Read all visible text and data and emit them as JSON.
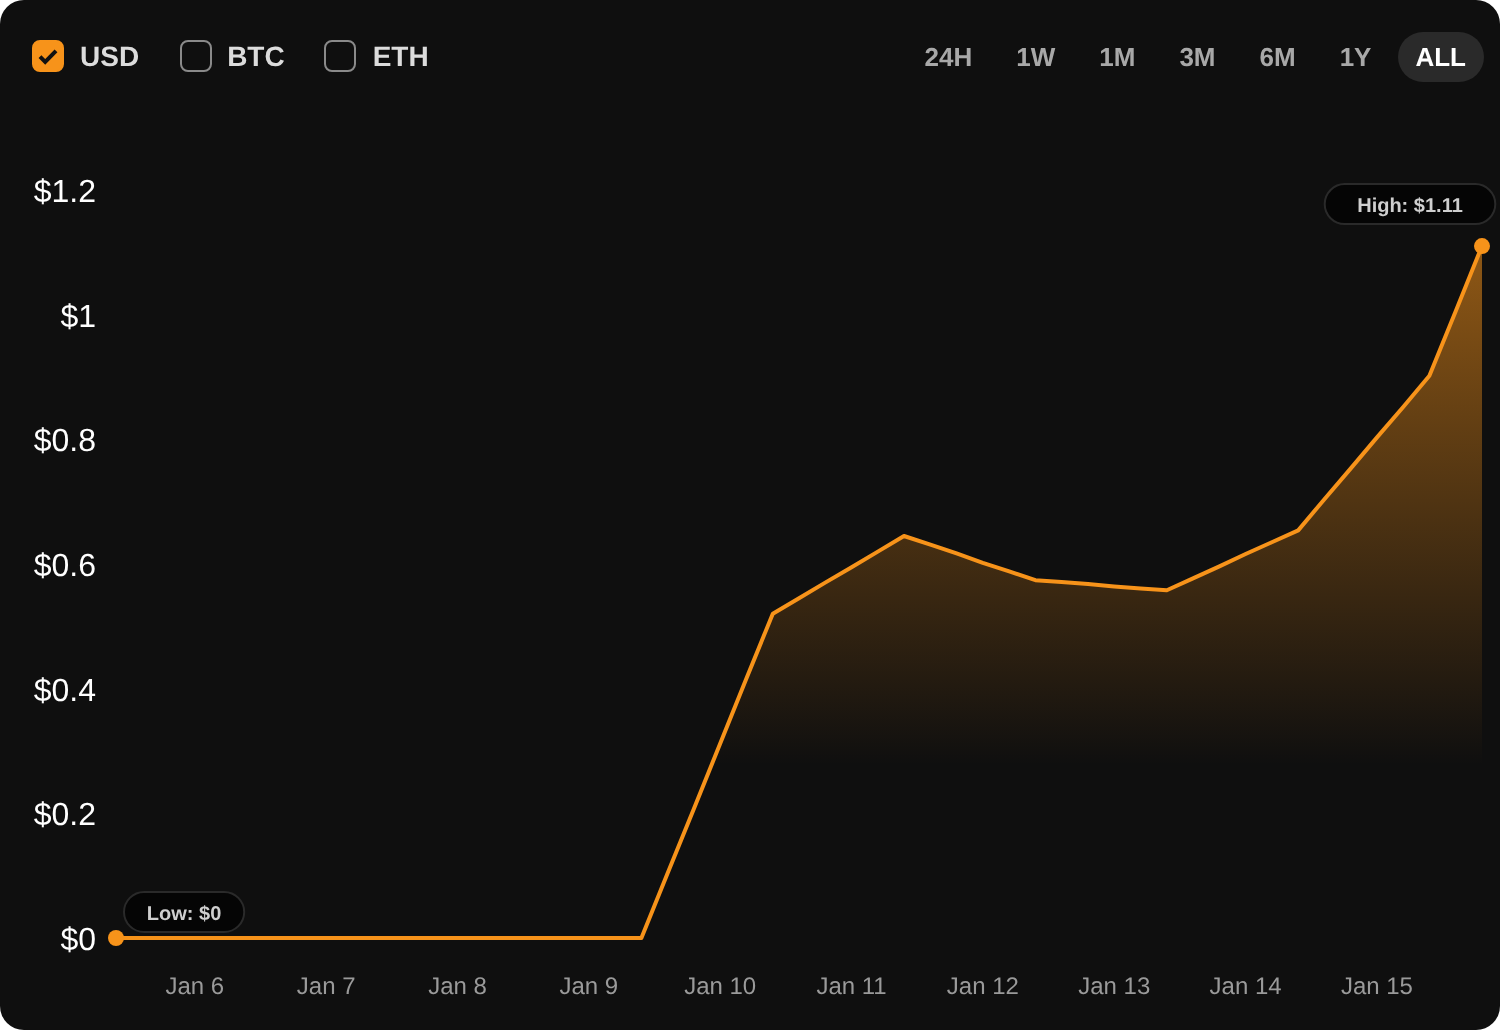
{
  "currencies": [
    {
      "label": "USD",
      "checked": true
    },
    {
      "label": "BTC",
      "checked": false
    },
    {
      "label": "ETH",
      "checked": false
    }
  ],
  "ranges": [
    {
      "label": "24H",
      "selected": false
    },
    {
      "label": "1W",
      "selected": false
    },
    {
      "label": "1M",
      "selected": false
    },
    {
      "label": "3M",
      "selected": false
    },
    {
      "label": "6M",
      "selected": false
    },
    {
      "label": "1Y",
      "selected": false
    },
    {
      "label": "ALL",
      "selected": true
    }
  ],
  "chart": {
    "chart_data": {
      "type": "area",
      "categories": [
        null,
        null,
        null,
        "Jan 6",
        null,
        null,
        null,
        null,
        "Jan 7",
        null,
        null,
        null,
        null,
        "Jan 8",
        null,
        null,
        null,
        null,
        "Jan 9",
        null,
        null,
        null,
        null,
        "Jan 10",
        null,
        null,
        null,
        null,
        "Jan 11",
        null,
        null,
        null,
        null,
        "Jan 12",
        null,
        null,
        null,
        null,
        "Jan 13",
        null,
        null,
        null,
        null,
        "Jan 14",
        null,
        null,
        null,
        null,
        "Jan 15",
        null,
        null,
        null,
        null
      ],
      "series": [
        {
          "color": "#f7931a",
          "values": [
            0,
            0,
            0,
            0,
            0,
            0,
            0,
            0,
            0,
            0,
            0,
            0,
            0,
            0,
            0,
            0,
            0,
            0,
            0,
            0,
            0,
            0.104,
            0.208,
            0.312,
            0.416,
            0.52,
            0.545,
            0.57,
            0.595,
            0.62,
            0.645,
            0.631,
            0.617,
            0.602,
            0.588,
            0.574,
            0.571,
            0.568,
            0.564,
            0.561,
            0.558,
            0.577,
            0.596,
            0.616,
            0.635,
            0.654,
            0.704,
            0.753,
            0.803,
            0.852,
            0.902,
            1.006,
            1.11
          ]
        }
      ],
      "ylim": [
        0,
        1.2
      ],
      "yticks": [
        {
          "value": 0,
          "label": "$0"
        },
        {
          "value": 0.2,
          "label": "$0.2"
        },
        {
          "value": 0.4,
          "label": "$0.4"
        },
        {
          "value": 0.6,
          "label": "$0.6"
        },
        {
          "value": 0.8,
          "label": "$0.8"
        },
        {
          "value": 1,
          "label": "$1"
        },
        {
          "value": 1.2,
          "label": "$1.2"
        }
      ],
      "annotations": [
        "Low: $0",
        "High: $1.11"
      ]
    }
  }
}
